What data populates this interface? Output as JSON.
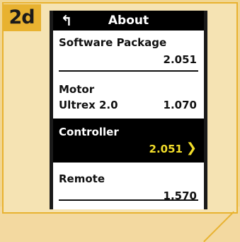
{
  "step": "2d",
  "header": {
    "title": "About",
    "back_icon": "back-arrow-icon"
  },
  "rows": {
    "software": {
      "label": "Software Package",
      "value": "2.051"
    },
    "motor": {
      "label": "Motor",
      "sub_label": "Ultrex 2.0",
      "value": "1.070"
    },
    "controller": {
      "label": "Controller",
      "value": "2.051",
      "chevron_icon": "chevron-right-icon"
    },
    "remote": {
      "label": "Remote",
      "value": "1.570"
    }
  },
  "colors": {
    "accent": "#e8b230",
    "highlight": "#f2dd2a",
    "screen_bg": "#ffffff",
    "selected_bg": "#000000"
  }
}
